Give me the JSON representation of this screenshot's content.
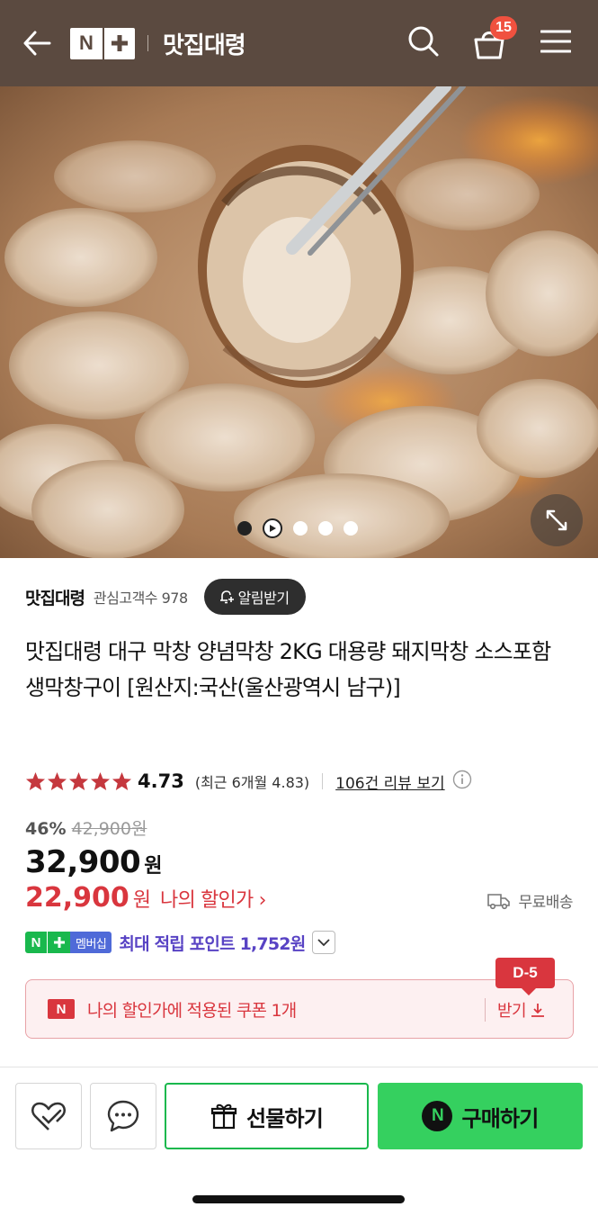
{
  "header": {
    "logo_n": "N",
    "store_title": "맛집대령",
    "cart_count": "15",
    "icons": [
      "back-arrow-icon",
      "search-icon",
      "cart-icon",
      "menu-icon"
    ]
  },
  "gallery": {
    "slides": 5,
    "active_slide": 1
  },
  "store": {
    "name": "맛집대령",
    "fans": "관심고객수 978",
    "alarm_label": "알림받기"
  },
  "product": {
    "title": "맛집대령 대구 막창 양념막창 2KG 대용량 돼지막창 소스포함 생막창구이 [원산지:국산(울산광역시 남구)]"
  },
  "rating": {
    "stars": 5,
    "value": "4.73",
    "recent": "(최근 6개월 4.83)",
    "review_link": "106건 리뷰 보기"
  },
  "price": {
    "discount_pct": "46%",
    "original": "42,900원",
    "current": "32,900",
    "won": "원",
    "my_discount": "22,900",
    "my_discount_won": "원",
    "my_discount_label": "나의 할인가 ›",
    "free_shipping": "무료배송"
  },
  "membership": {
    "badge_n": "N",
    "badge_text": "멤버십",
    "points": "최대 적립 포인트 1,752원"
  },
  "coupon": {
    "badge": "N",
    "text": "나의 할인가에 적용된 쿠폰 1개",
    "get_label": "받기",
    "dday": "D-5"
  },
  "bottom_bar": {
    "gift_label": "선물하기",
    "buy_n": "N",
    "buy_label": "구매하기"
  },
  "colors": {
    "header_bg": "#5b4a40",
    "accent_red": "#d9363e",
    "naver_green": "#35d05f",
    "points_purple": "#5843c4"
  }
}
